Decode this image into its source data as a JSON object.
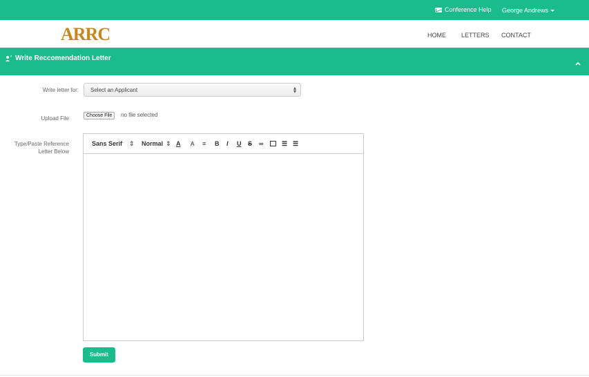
{
  "topbar": {
    "help_label": "Conference Help",
    "help_icon": "envelope-icon",
    "user_name": "George Andrews"
  },
  "header": {
    "logo_text": "ARRC",
    "nav": [
      "HOME",
      "LETTERS",
      "CONTACT"
    ]
  },
  "panel": {
    "title": "Write Reccomendation Letter",
    "title_icon": "writer-icon"
  },
  "form": {
    "write_for_label": "Write letter for:",
    "applicant_select_value": "Select an Applicant",
    "upload_label": "Upload File",
    "choose_file_label": "Choose File",
    "file_status": "no file selected",
    "letter_label_line1": "Type/Paste Reference",
    "letter_label_line2": "Letter Below",
    "toolbar": {
      "font": "Sans Serif",
      "size": "Normal"
    },
    "submit_label": "Submit"
  },
  "colors": {
    "accent": "#1bbc8c",
    "logo_a": "#c8861e"
  }
}
